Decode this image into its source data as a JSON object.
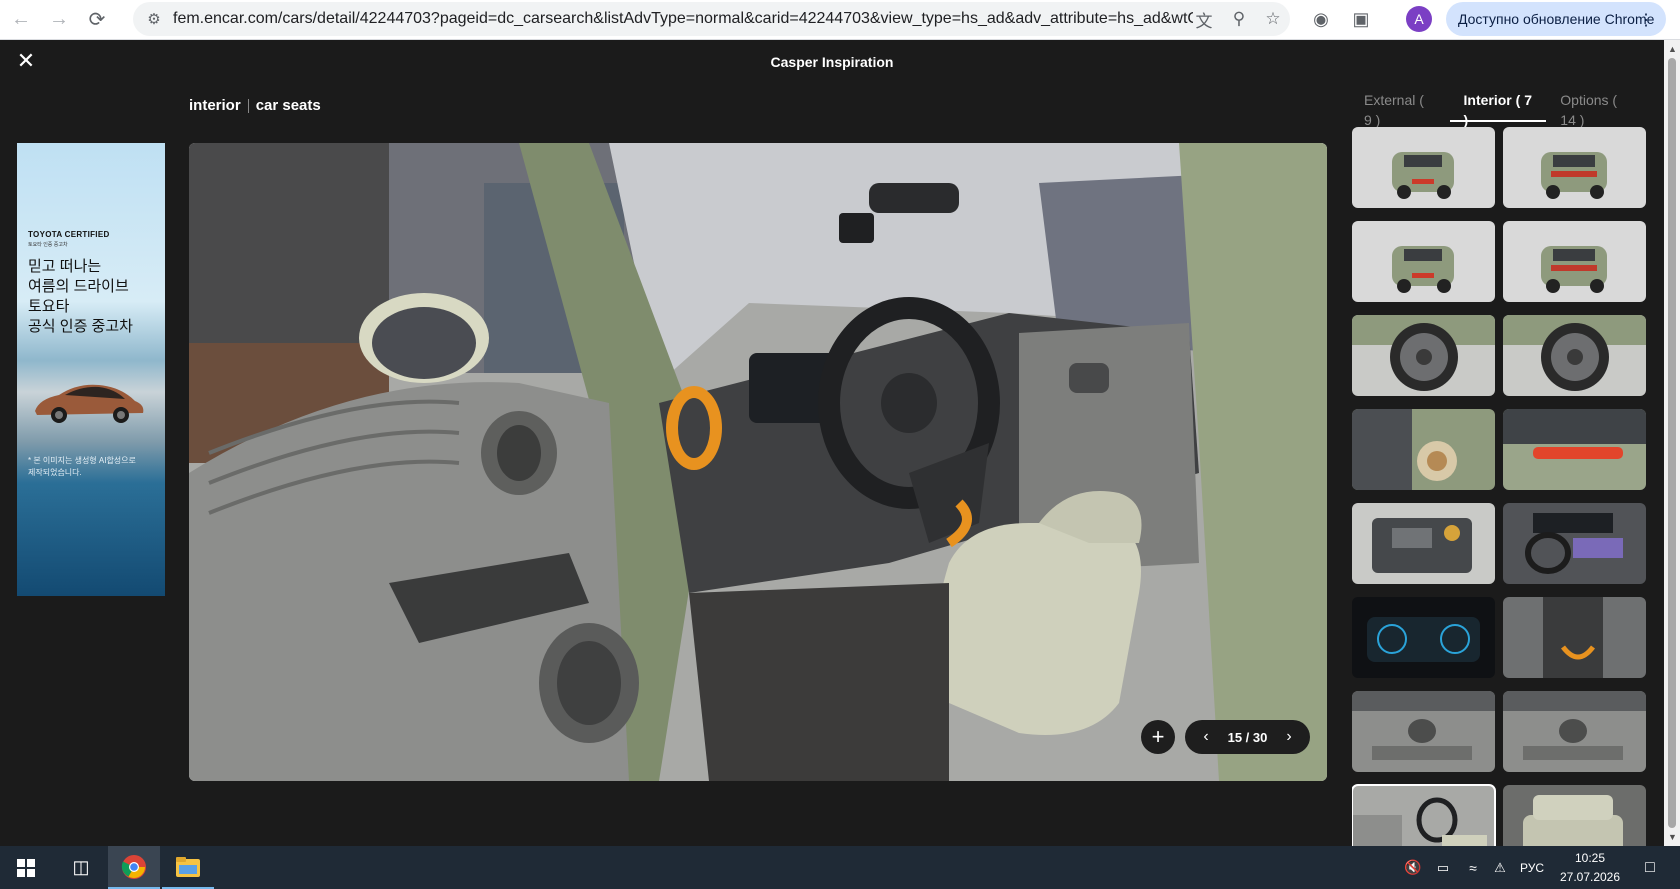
{
  "browser": {
    "url": "fem.encar.com/cars/detail/42244703?pageid=dc_carsearch&listAdvType=normal&carid=42244703&view_type=hs_ad&adv_attribute=hs_ad&wtCli...",
    "profile_initial": "A",
    "update_label": "Доступно обновление Chrome",
    "icons": [
      "back-icon",
      "forward-icon",
      "reload-icon",
      "site-info-icon",
      "translate-icon",
      "zoom-icon",
      "star-icon",
      "extension-globe-icon",
      "extensions-puzzle-icon",
      "menu-dots-icon"
    ]
  },
  "viewer": {
    "title": "Casper Inspiration",
    "caption_category": "interior",
    "caption_item": "car seats",
    "tabs": [
      {
        "label": "External ( 9 )",
        "active": false
      },
      {
        "label": "Interior ( 7 )",
        "active": true
      },
      {
        "label": "Options ( 14 )",
        "active": false
      }
    ],
    "pager": {
      "label": "15 / 30",
      "current": 15,
      "total": 30
    }
  },
  "ad": {
    "brand": "TOYOTA CERTIFIED",
    "brand_sub": "토요타 인증 중고차",
    "slogan": "믿고 떠나는\n여름의 드라이브\n토요타\n공식 인증 중고차",
    "note": "* 본 이미지는 생성형 AI합성으로\n제작되었습니다."
  },
  "thumbnails": [
    {
      "kind": "car-front",
      "row": 0,
      "col": 0
    },
    {
      "kind": "car-rear",
      "row": 0,
      "col": 1
    },
    {
      "kind": "car-front",
      "row": 1,
      "col": 0
    },
    {
      "kind": "car-rear",
      "row": 1,
      "col": 1
    },
    {
      "kind": "wheel",
      "row": 2,
      "col": 0
    },
    {
      "kind": "wheel",
      "row": 2,
      "col": 1
    },
    {
      "kind": "headlight",
      "row": 3,
      "col": 0
    },
    {
      "kind": "taillight",
      "row": 3,
      "col": 1
    },
    {
      "kind": "engine",
      "row": 4,
      "col": 0
    },
    {
      "kind": "dashboard",
      "row": 4,
      "col": 1
    },
    {
      "kind": "cluster",
      "row": 5,
      "col": 0
    },
    {
      "kind": "console",
      "row": 5,
      "col": 1
    },
    {
      "kind": "door",
      "row": 6,
      "col": 0
    },
    {
      "kind": "door",
      "row": 6,
      "col": 1
    },
    {
      "kind": "seat-selected",
      "row": 7,
      "col": 0
    },
    {
      "kind": "rear-seat",
      "row": 7,
      "col": 1
    }
  ],
  "taskbar": {
    "language": "РУС",
    "time": "10:25",
    "date": "27.07.2026"
  },
  "colors": {
    "viewer_bg": "#1b1b1b",
    "accent_update": "#d3e3fd",
    "taskbar_bg": "#1f2a36",
    "car_green": "#8e9a7d",
    "trim_orange": "#e8921f"
  }
}
